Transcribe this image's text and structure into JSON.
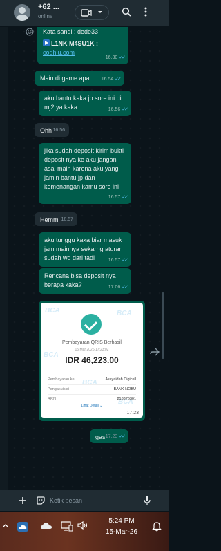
{
  "header": {
    "contact_name": "+62 ...",
    "status": "online"
  },
  "messages": [
    {
      "id": "m0",
      "type": "out-link",
      "line1": "Kata sandi : dede33",
      "line2": "L1NK M4SU1K :",
      "url": "codhiu.com",
      "time": "16.30"
    },
    {
      "id": "m1",
      "type": "out",
      "text": "Main di game apa",
      "time": "16.54"
    },
    {
      "id": "m2",
      "type": "out",
      "text": "aku bantu kaka jp sore ini di\nmj2 ya kaka",
      "time": "16.56"
    },
    {
      "id": "m3",
      "type": "in",
      "text": "Ohh",
      "time": "16.56"
    },
    {
      "id": "m4",
      "type": "out",
      "text": "jika sudah deposit kirim bukti\ndeposit nya ke aku jangan\nasal main karena aku yang\njamin bantu jp dan\nkemenangan kamu sore ini",
      "time": "16.57"
    },
    {
      "id": "m5",
      "type": "in",
      "text": "Hemm",
      "time": "16.57"
    },
    {
      "id": "m6",
      "type": "out",
      "text": "aku tunggu kaka biar masuk\njam mainnya sekarng aturan\nsudah wd dari tadi",
      "time": "16.57"
    },
    {
      "id": "m7",
      "type": "out",
      "text": "Rencana bisa deposit nya\nberapa kaka?",
      "time": "17.06"
    },
    {
      "id": "m9",
      "type": "in",
      "text": "gas",
      "time": "17.23"
    }
  ],
  "receipt": {
    "watermark": "BCA",
    "title": "Pembayaran QRIS Berhasil",
    "date": "15 Mar 2026 17:23:02",
    "amount": "IDR 46,223.00",
    "rows": [
      {
        "label": "Pembayaran ke",
        "value": "Assyaidah Digicell"
      },
      {
        "label": "Pengakuisisi",
        "value": "BANK NOBU"
      },
      {
        "label": "RRN",
        "value": "218376301"
      }
    ],
    "detail_link": "Lihat Detail",
    "time": "17.23"
  },
  "composer": {
    "placeholder": "Ketik pesan"
  },
  "taskbar": {
    "time": "5:24 PM",
    "date": "15-Mar-26"
  },
  "colors": {
    "outgoing_bubble": "#005c4b",
    "incoming_bubble": "#202c33",
    "read_ticks": "#53bdeb",
    "background": "#0b141a"
  }
}
